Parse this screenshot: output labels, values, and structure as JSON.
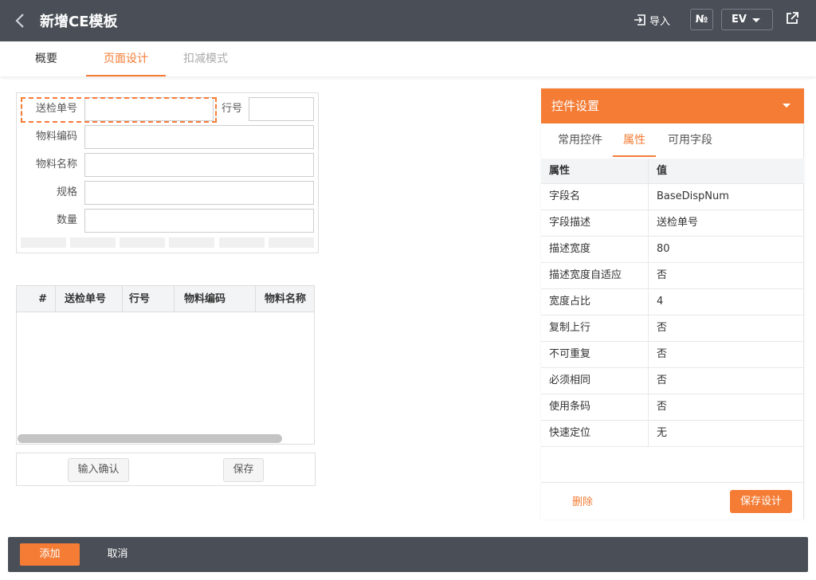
{
  "header": {
    "title": "新增CE模板",
    "import_label": "导入",
    "no_label": "№",
    "ev_value": "EV"
  },
  "tabs": [
    {
      "label": "概要"
    },
    {
      "label": "页面设计"
    },
    {
      "label": "扣减模式"
    }
  ],
  "form": {
    "fields": [
      {
        "label": "送检单号"
      },
      {
        "label": "行号"
      },
      {
        "label": "物料编码"
      },
      {
        "label": "物料名称"
      },
      {
        "label": "规格"
      },
      {
        "label": "数量"
      }
    ]
  },
  "grid": {
    "columns": [
      "#",
      "送检单号",
      "行号",
      "物料编码",
      "物料名称"
    ]
  },
  "actions": {
    "confirm_label": "输入确认",
    "save_label": "保存"
  },
  "panel": {
    "title": "控件设置",
    "tabs": [
      "常用控件",
      "属性",
      "可用字段"
    ],
    "header_key": "属性",
    "header_value": "值",
    "properties": [
      {
        "key": "字段名",
        "value": "BaseDispNum"
      },
      {
        "key": "字段描述",
        "value": "送检单号"
      },
      {
        "key": "描述宽度",
        "value": "80"
      },
      {
        "key": "描述宽度自适应",
        "value": "否"
      },
      {
        "key": "宽度占比",
        "value": "4"
      },
      {
        "key": "复制上行",
        "value": "否"
      },
      {
        "key": "不可重复",
        "value": "否"
      },
      {
        "key": "必须相同",
        "value": "否"
      },
      {
        "key": "使用条码",
        "value": "否"
      },
      {
        "key": "快速定位",
        "value": "无"
      }
    ],
    "delete_label": "删除",
    "save_design_label": "保存设计"
  },
  "footer": {
    "add_label": "添加",
    "cancel_label": "取消"
  },
  "colors": {
    "accent": "#f47c35",
    "header_bg": "#4a4f57"
  }
}
